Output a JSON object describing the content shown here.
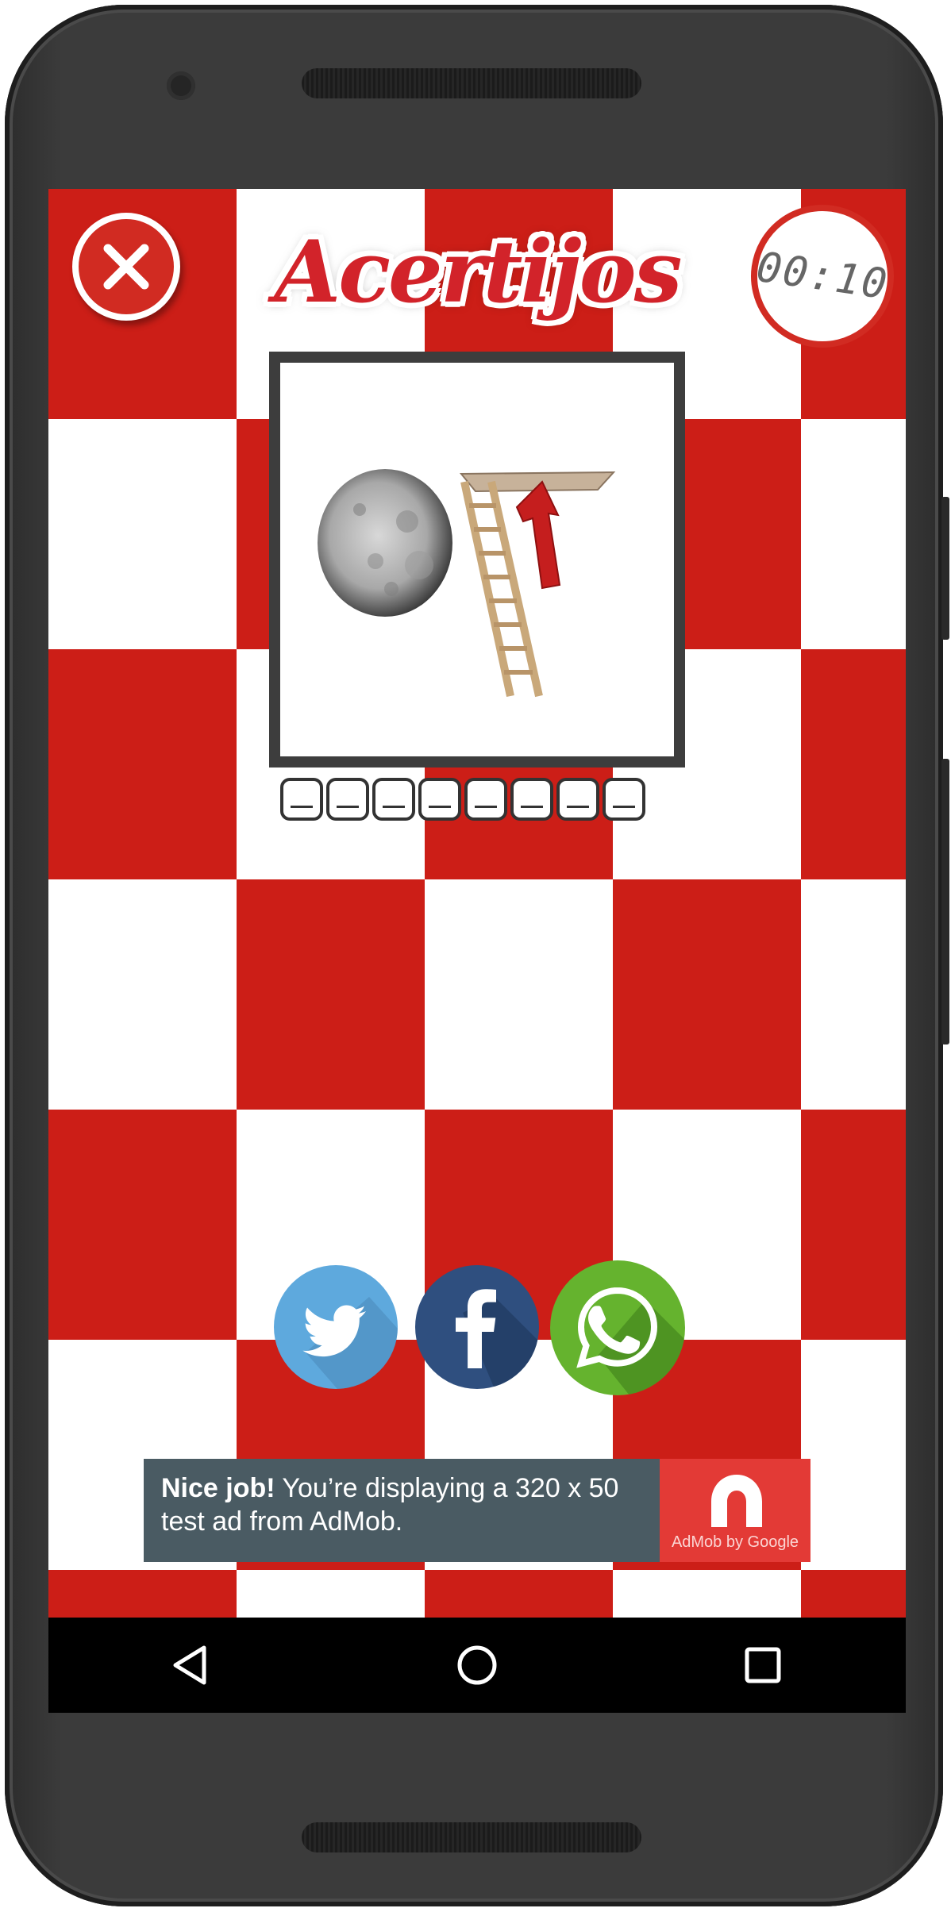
{
  "app": {
    "title": "Acertijos",
    "timer": "00:10"
  },
  "puzzle": {
    "image_description_icons": [
      "moon-icon",
      "attic-ladder-icon",
      "up-arrow-icon"
    ],
    "answer_slots": [
      "_",
      "_",
      "_",
      "_",
      "_",
      "_",
      "_",
      "_"
    ]
  },
  "share": {
    "buttons": [
      "twitter-icon",
      "facebook-icon",
      "whatsapp-icon"
    ]
  },
  "ad": {
    "bold": "Nice job!",
    "text": " You’re displaying a 320 x 50 test ad from AdMob.",
    "brand": "AdMob by Google"
  },
  "colors": {
    "red": "#cc1e17",
    "twitter": "#5ea9dd",
    "facebook": "#3b5998",
    "whatsapp": "#65b32e",
    "ad_bg": "#4a5b63",
    "ad_logo_bg": "#e33a36"
  }
}
